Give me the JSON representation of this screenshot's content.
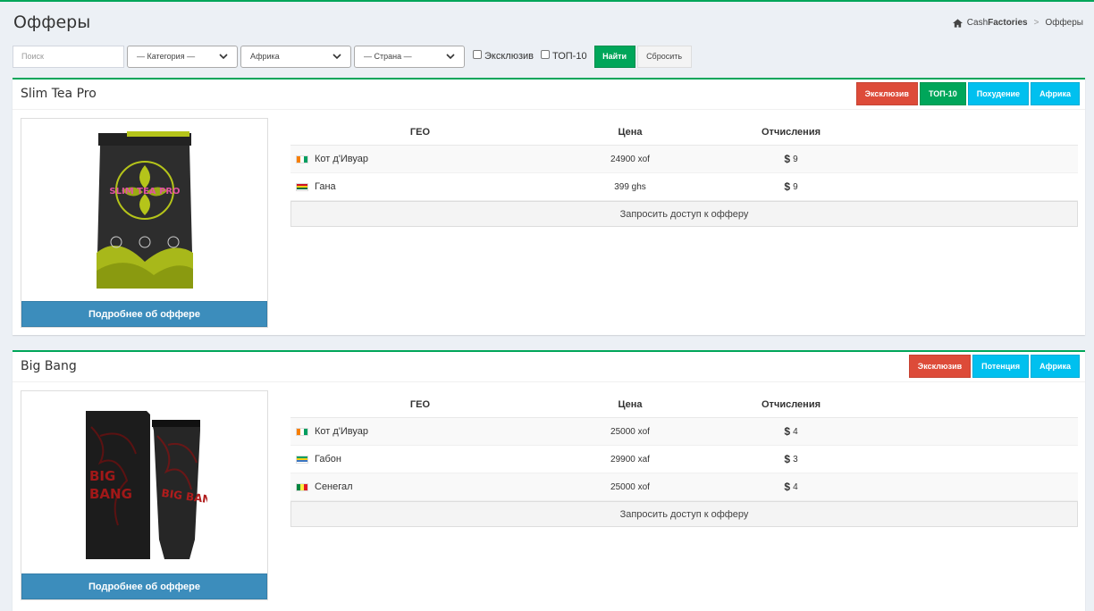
{
  "page": {
    "title": "Офферы"
  },
  "breadcrumb": {
    "brand_light": "Cash",
    "brand_bold": "Factories",
    "current": "Офферы"
  },
  "filters": {
    "search_placeholder": "Поиск",
    "category": "— Категория —",
    "region": "Африка",
    "country": "— Страна —",
    "exclusive_label": "Эксклюзив",
    "top10_label": "ТОП-10",
    "find_label": "Найти",
    "reset_label": "Сбросить"
  },
  "table_headers": {
    "geo": "ГЕО",
    "price": "Цена",
    "payout": "Отчисления"
  },
  "offers": [
    {
      "name": "Slim Tea Pro",
      "tags": [
        {
          "label": "Эксклюзив",
          "color": "red"
        },
        {
          "label": "ТОП-10",
          "color": "green"
        },
        {
          "label": "Похудение",
          "color": "aqua"
        },
        {
          "label": "Африка",
          "color": "aqua"
        }
      ],
      "package_text": "SLIM TEA PRO",
      "rows": [
        {
          "geo": "Кот д'Ивуар",
          "flag": "ci",
          "price": "24900 xof",
          "payout": "9"
        },
        {
          "geo": "Гана",
          "flag": "gh",
          "price": "399 ghs",
          "payout": "9"
        }
      ],
      "request_label": "Запросить доступ к офферу",
      "more_label": "Подробнее об оффере"
    },
    {
      "name": "Big Bang",
      "tags": [
        {
          "label": "Эксклюзив",
          "color": "red"
        },
        {
          "label": "Потенция",
          "color": "aqua"
        },
        {
          "label": "Африка",
          "color": "aqua"
        }
      ],
      "package_text": "BIG BANG",
      "rows": [
        {
          "geo": "Кот д'Ивуар",
          "flag": "ci",
          "price": "25000 xof",
          "payout": "4"
        },
        {
          "geo": "Габон",
          "flag": "ga",
          "price": "29900 xaf",
          "payout": "3"
        },
        {
          "geo": "Сенегал",
          "flag": "sn",
          "price": "25000 xof",
          "payout": "4"
        }
      ],
      "request_label": "Запросить доступ к офферу",
      "more_label": "Подробнее об оффере"
    }
  ],
  "colors": {
    "accent": "#00a65a",
    "primary": "#3c8dbc",
    "danger": "#dd4b39",
    "info": "#00c0ef"
  },
  "currency_symbol": "$"
}
